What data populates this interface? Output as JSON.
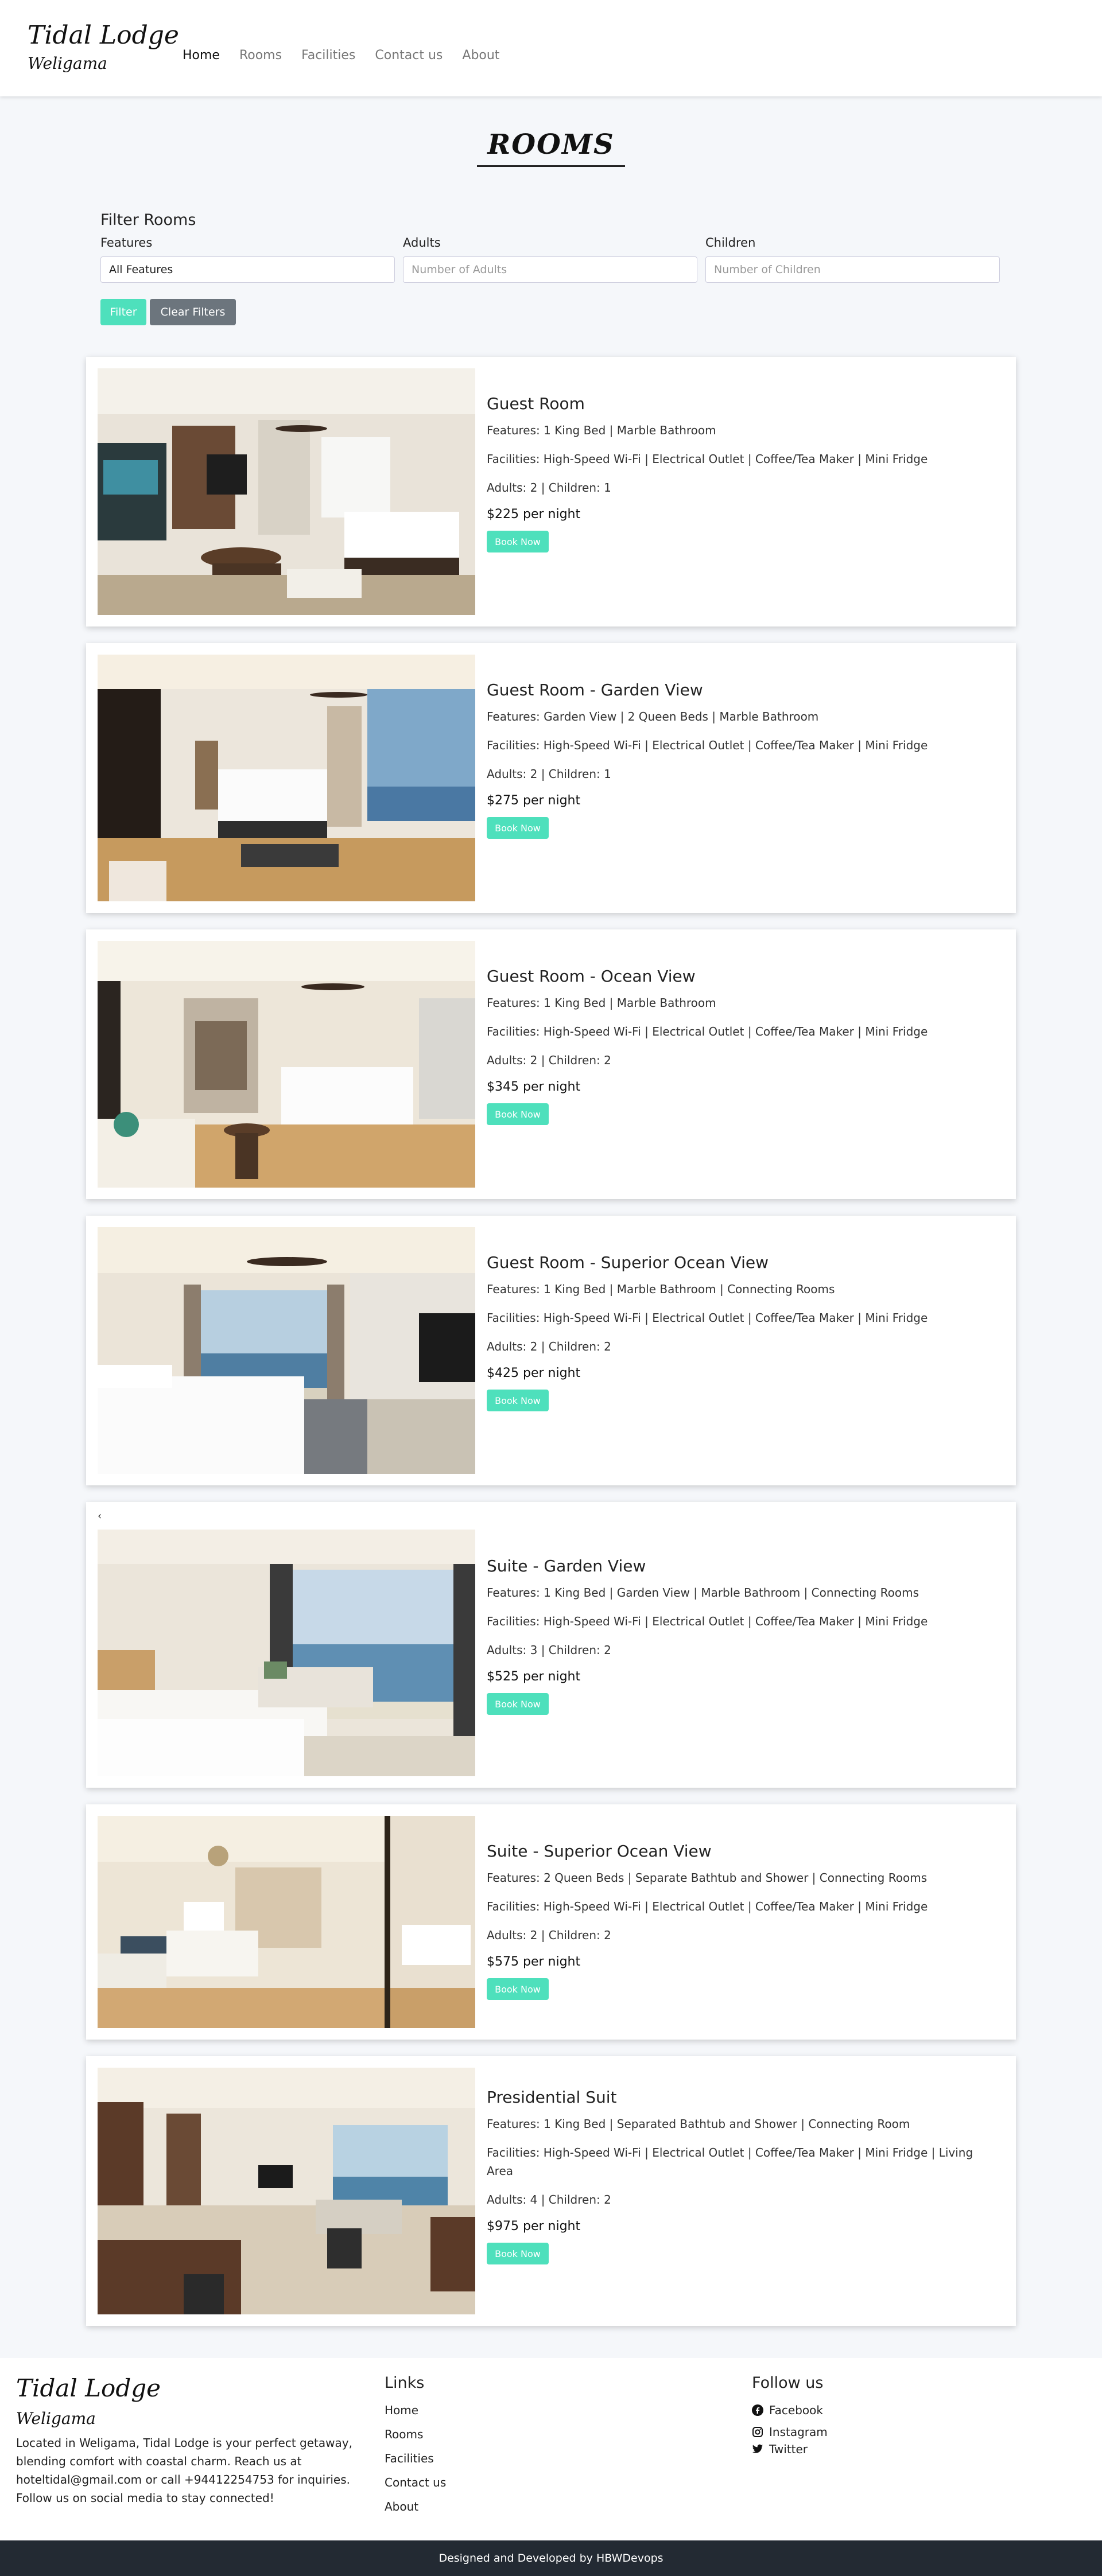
{
  "header": {
    "logo_title": "Tidal Lodge",
    "logo_subtitle": "Weligama",
    "nav": [
      {
        "label": "Home",
        "active": true
      },
      {
        "label": "Rooms",
        "active": false
      },
      {
        "label": "Facilities",
        "active": false
      },
      {
        "label": "Contact us",
        "active": false
      },
      {
        "label": "About",
        "active": false
      }
    ]
  },
  "page_title": "ROOMS",
  "filter": {
    "title": "Filter Rooms",
    "features_label": "Features",
    "features_value": "All Features",
    "adults_label": "Adults",
    "adults_placeholder": "Number of Adults",
    "children_label": "Children",
    "children_placeholder": "Number of Children",
    "filter_button": "Filter",
    "clear_button": "Clear Filters"
  },
  "book_label": "Book Now",
  "rooms": [
    {
      "name": "Guest Room",
      "features": "Features: 1 King Bed | Marble Bathroom",
      "facilities": "Facilities: High-Speed Wi-Fi | Electrical Outlet | Coffee/Tea Maker | Mini Fridge",
      "occupancy": "Adults: 2 | Children: 1",
      "price": "$225 per night"
    },
    {
      "name": "Guest Room - Garden View",
      "features": "Features: Garden View | 2 Queen Beds | Marble Bathroom",
      "facilities": "Facilities: High-Speed Wi-Fi | Electrical Outlet | Coffee/Tea Maker | Mini Fridge",
      "occupancy": "Adults: 2 | Children: 1",
      "price": "$275 per night"
    },
    {
      "name": "Guest Room - Ocean View",
      "features": "Features: 1 King Bed | Marble Bathroom",
      "facilities": "Facilities: High-Speed Wi-Fi | Electrical Outlet | Coffee/Tea Maker | Mini Fridge",
      "occupancy": "Adults: 2 | Children: 2",
      "price": "$345 per night"
    },
    {
      "name": "Guest Room - Superior Ocean View",
      "features": "Features: 1 King Bed | Marble Bathroom | Connecting Rooms",
      "facilities": "Facilities: High-Speed Wi-Fi | Electrical Outlet | Coffee/Tea Maker | Mini Fridge",
      "occupancy": "Adults: 2 | Children: 2",
      "price": "$425 per night"
    },
    {
      "name": "Suite - Garden View",
      "features": "Features: 1 King Bed | Garden View | Marble Bathroom | Connecting Rooms",
      "facilities": "Facilities: High-Speed Wi-Fi | Electrical Outlet | Coffee/Tea Maker | Mini Fridge",
      "occupancy": "Adults: 3 | Children: 2",
      "price": "$525 per night",
      "back_glyph": "‹"
    },
    {
      "name": "Suite - Superior Ocean View",
      "features": "Features: 2 Queen Beds | Separate Bathtub and Shower | Connecting Rooms",
      "facilities": "Facilities: High-Speed Wi-Fi | Electrical Outlet | Coffee/Tea Maker | Mini Fridge",
      "occupancy": "Adults: 2 | Children: 2",
      "price": "$575 per night"
    },
    {
      "name": "Presidential Suit",
      "features": "Features: 1 King Bed | Separated Bathtub and Shower | Connecting Room",
      "facilities": "Facilities: High-Speed Wi-Fi | Electrical Outlet | Coffee/Tea Maker | Mini Fridge | Living Area",
      "occupancy": "Adults: 4 | Children: 2",
      "price": "$975 per night"
    }
  ],
  "footer": {
    "logo_title": "Tidal Lodge",
    "logo_subtitle": "Weligama",
    "description": "Located in Weligama, Tidal Lodge is your perfect getaway, blending comfort with coastal charm. Reach us at hoteltidal@gmail.com or call +94412254753 for inquiries. Follow us on social media to stay connected!",
    "links_heading": "Links",
    "links": [
      "Home",
      "Rooms",
      "Facilities",
      "Contact us",
      "About"
    ],
    "follow_heading": "Follow us",
    "social": [
      {
        "label": "Facebook",
        "icon": "facebook-icon"
      },
      {
        "label": "Instagram",
        "icon": "instagram-icon"
      },
      {
        "label": "Twitter",
        "icon": "twitter-icon"
      }
    ],
    "credit": "Designed and Developed by HBWDevops"
  },
  "colors": {
    "accent": "#4ee0bc",
    "secondary_button": "#6c757d",
    "bottom_bar": "#232a33",
    "page_background": "#f5f7fa"
  }
}
